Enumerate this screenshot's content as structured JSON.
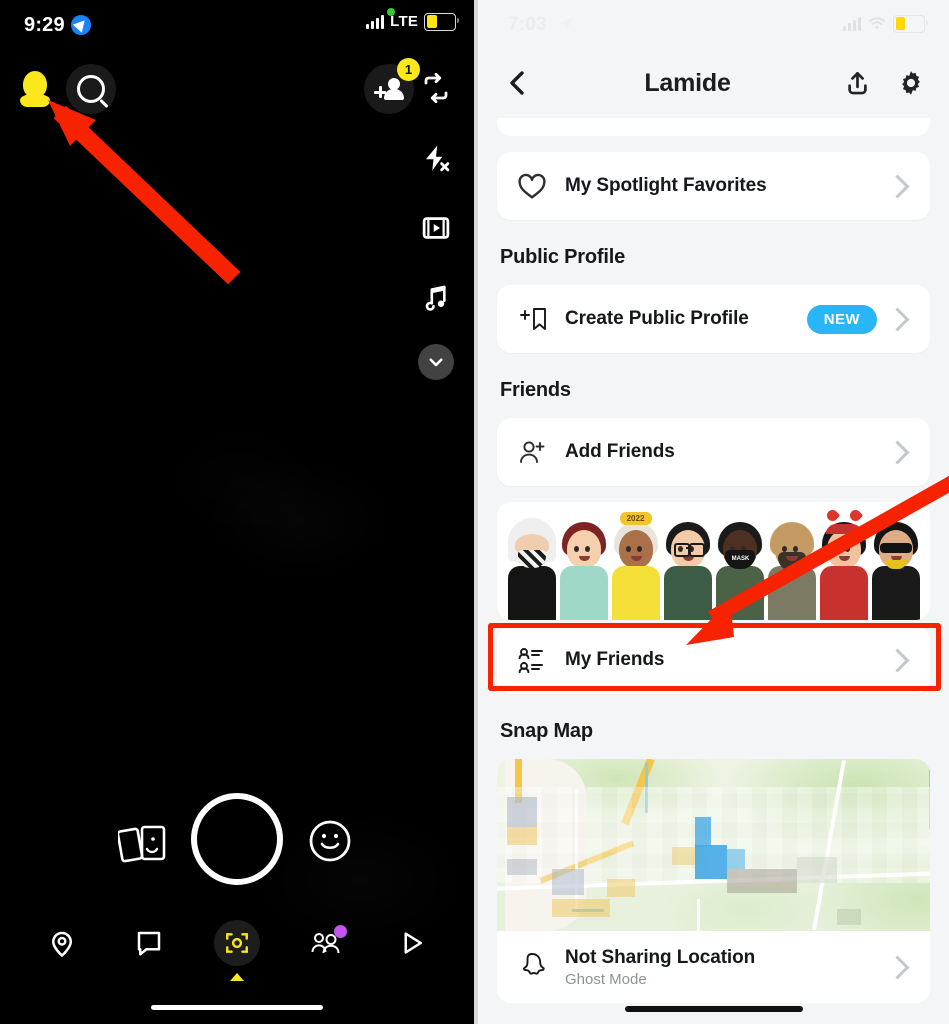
{
  "camera": {
    "status": {
      "time": "9:29",
      "network": "LTE",
      "location_icon": "location-arrow-icon",
      "battery_level": 38,
      "recording_dot": true
    },
    "top_controls": [
      {
        "name": "profile-avatar",
        "icon": "bitmoji-avatar-icon"
      },
      {
        "name": "search",
        "icon": "search-icon"
      },
      {
        "name": "add-friends",
        "icon": "add-person-icon",
        "badge": "1"
      },
      {
        "name": "flip-camera",
        "icon": "camera-flip-icon"
      }
    ],
    "rail": [
      {
        "name": "flip-camera",
        "icon": "camera-flip-icon"
      },
      {
        "name": "flash",
        "icon": "flash-off-icon"
      },
      {
        "name": "timer",
        "icon": "video-timer-icon"
      },
      {
        "name": "music",
        "icon": "music-note-icon"
      },
      {
        "name": "more",
        "icon": "chevron-down-icon"
      }
    ],
    "shutter": {
      "name": "shutter-button",
      "memories_icon": "memories-cards-icon",
      "lens_icon": "smiley-lens-icon"
    },
    "nav": [
      {
        "name": "map",
        "icon": "map-pin-icon",
        "active": false
      },
      {
        "name": "chat",
        "icon": "chat-bubble-icon",
        "active": false
      },
      {
        "name": "camera",
        "icon": "camera-icon",
        "active": true
      },
      {
        "name": "friends",
        "icon": "friends-icon",
        "active": false,
        "dot": "#c455f0"
      },
      {
        "name": "spotlight",
        "icon": "play-triangle-icon",
        "active": false
      }
    ]
  },
  "profile": {
    "status": {
      "time": "7:03",
      "location_icon": "location-arrow-icon",
      "wifi_icon": "wifi-icon",
      "battery_level": 36
    },
    "header": {
      "back_icon": "chevron-left-icon",
      "title": "Lamide",
      "share_icon": "share-upload-icon",
      "settings_icon": "gear-icon"
    },
    "rows": {
      "spotlight_favorites": {
        "label": "My Spotlight Favorites",
        "icon": "heart-icon"
      },
      "create_public_profile": {
        "label": "Create Public Profile",
        "icon": "bookmark-plus-icon",
        "badge": "NEW"
      },
      "add_friends": {
        "label": "Add Friends",
        "icon": "person-plus-icon"
      },
      "my_friends": {
        "label": "My Friends",
        "icon": "contact-list-icon"
      },
      "snap_map_status": {
        "label": "Not Sharing Location",
        "sublabel": "Ghost Mode",
        "icon": "ghost-icon"
      }
    },
    "sections": {
      "public_profile": "Public Profile",
      "friends": "Friends",
      "snap_map": "Snap Map"
    },
    "bitmojis": [
      {
        "name": "friend-1",
        "skin": "#f0cdae",
        "hair": "#efefef",
        "shirt": "#141414",
        "accessory": "keffiyeh-mask"
      },
      {
        "name": "friend-2",
        "skin": "#f5cfae",
        "hair": "#7e2522",
        "shirt": "#9fd8c8",
        "accessory": "none"
      },
      {
        "name": "friend-3",
        "skin": "#a9704a",
        "hair": "#e8e4dc",
        "shirt": "#f5e03a",
        "accessory": "2022-crown"
      },
      {
        "name": "friend-4",
        "skin": "#f3cba8",
        "hair": "#1b1b1b",
        "shirt": "#3d5c45",
        "accessory": "glasses"
      },
      {
        "name": "friend-5",
        "skin": "#4d3021",
        "hair": "#1b1b1b",
        "shirt": "#4b6246",
        "accessory": "black-mask"
      },
      {
        "name": "friend-6",
        "skin": "#c59a63",
        "hair": "#c59a63",
        "shirt": "#7c7a63",
        "accessory": "beard"
      },
      {
        "name": "friend-7",
        "skin": "#f0c29d",
        "hair": "#171717",
        "shirt": "#c8322e",
        "accessory": "heart-headband"
      },
      {
        "name": "friend-8",
        "skin": "#e0ae86",
        "hair": "#151515",
        "shirt": "#1a1a1a",
        "accessory": "sunglasses"
      }
    ]
  },
  "annotations": {
    "arrow_color": "#f62200",
    "highlight_box": "my-friends-row"
  }
}
